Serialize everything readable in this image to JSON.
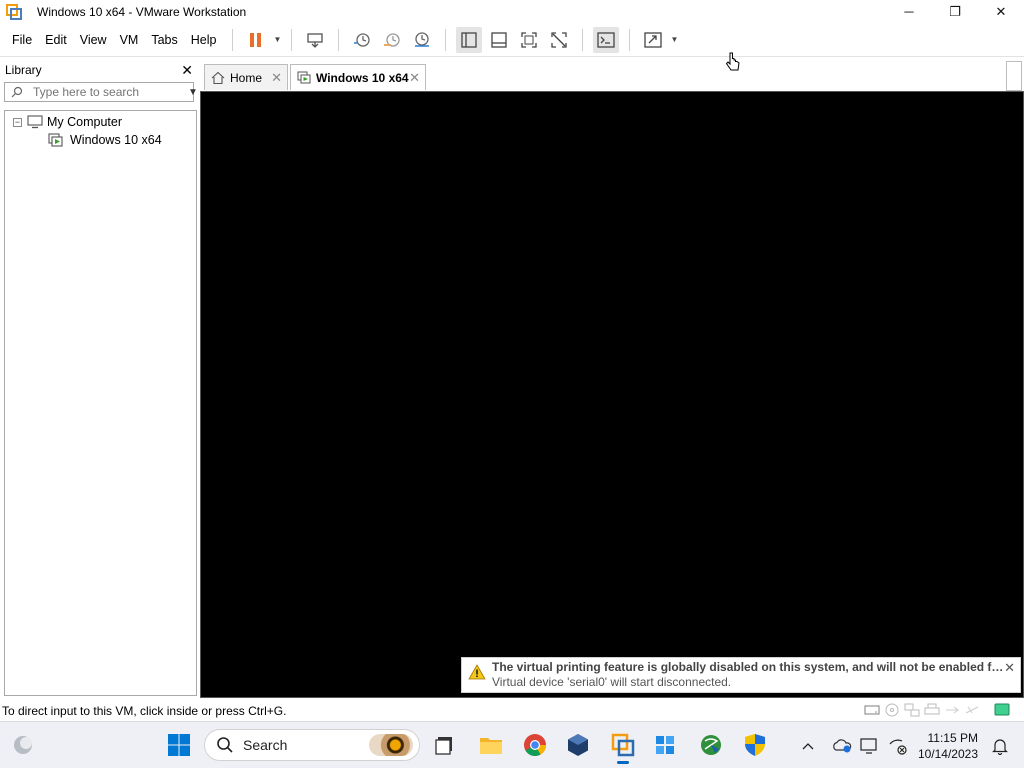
{
  "window": {
    "title": "Windows 10 x64 - VMware Workstation",
    "minimize_label": "─",
    "restore_label": "❐",
    "close_label": "✕"
  },
  "menubar": {
    "items": [
      {
        "label": "File"
      },
      {
        "label": "Edit"
      },
      {
        "label": "View"
      },
      {
        "label": "VM"
      },
      {
        "label": "Tabs"
      },
      {
        "label": "Help"
      }
    ]
  },
  "toolbar": {
    "accent_pause": "#e8702a",
    "buttons": [
      "pause-icon",
      "send-ctrl-alt-del-icon",
      "snapshot-take-icon",
      "snapshot-revert-icon",
      "snapshot-manager-icon",
      "show-library-icon",
      "show-thumbnail-icon",
      "full-screen-icon",
      "unity-icon",
      "console-view-icon",
      "stretch-guest-icon"
    ]
  },
  "library": {
    "title": "Library",
    "close_label": "✕",
    "search_placeholder": "Type here to search",
    "tree": {
      "root": {
        "label": "My Computer",
        "toggle": "−"
      },
      "child": {
        "label": "Windows 10 x64"
      }
    }
  },
  "tabs": [
    {
      "label": "Home",
      "close": "✕"
    },
    {
      "label": "Windows 10 x64",
      "close": "✕"
    }
  ],
  "notification": {
    "line1": "The virtual printing feature is globally disabled on this system, and will not be enabled for t...",
    "line2": "Virtual device 'serial0' will start disconnected.",
    "close": "✕"
  },
  "statusbar": {
    "text": "To direct input to this VM, click inside or press Ctrl+G.",
    "device_icons": [
      "hard-disk-icon",
      "cd-dvd-icon",
      "network-adapter-icon",
      "printer-icon",
      "usb-icon",
      "sound-icon",
      "message-icon"
    ]
  },
  "taskbar": {
    "search_label": "Search",
    "apps": [
      "weather-icon",
      "start-icon",
      "search-icon",
      "task-view-icon",
      "file-explorer-icon",
      "chrome-icon",
      "virtualbox-icon",
      "vmware-icon",
      "windows-store-icon",
      "internet-download-manager-icon",
      "security-shield-icon"
    ],
    "tray": {
      "time": "11:15 PM",
      "date": "10/14/2023"
    }
  }
}
